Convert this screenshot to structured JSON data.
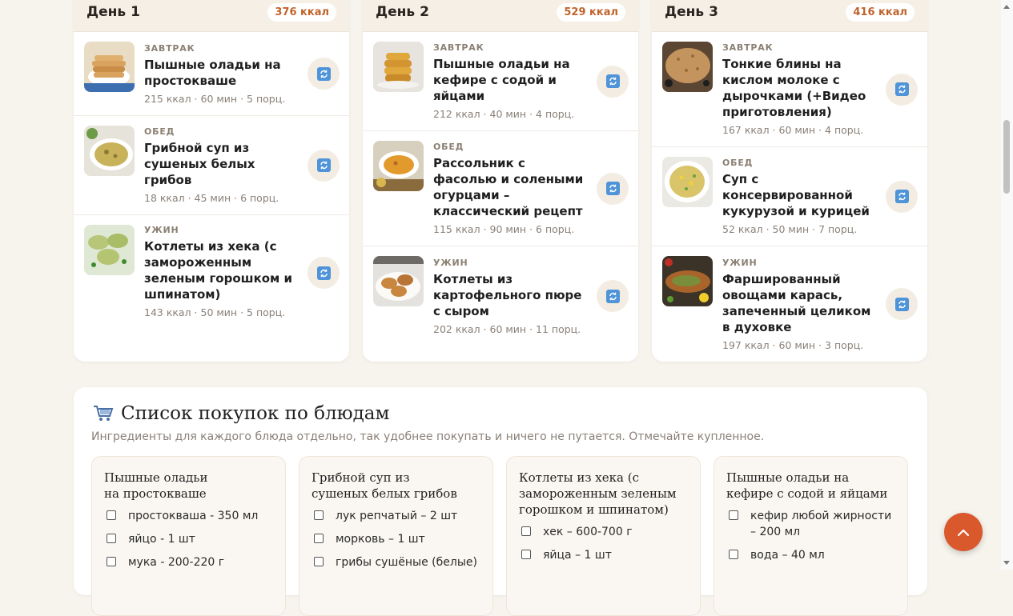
{
  "days": [
    {
      "title": "День 1",
      "kcal": "376 ккал",
      "meals": [
        {
          "type": "ЗАВТРАК",
          "name": "Пышные оладьи на простокваше",
          "meta": "215 ккал · 60 мин · 5 порц.",
          "image": "pancakes-photo"
        },
        {
          "type": "ОБЕД",
          "name": "Грибной суп из сушеных белых грибов",
          "meta": "18 ккал · 45 мин · 6 порц.",
          "image": "mushroom-soup-photo"
        },
        {
          "type": "УЖИН",
          "name": "Котлеты из хека (с замороженным зеленым горошком и шпинатом)",
          "meta": "143 ккал · 50 мин · 5 порц.",
          "image": "fish-cutlets-photo"
        }
      ]
    },
    {
      "title": "День 2",
      "kcal": "529 ккал",
      "meals": [
        {
          "type": "ЗАВТРАК",
          "name": "Пышные оладьи на кефире с содой и яйцами",
          "meta": "212 ккал · 40 мин · 4 порц.",
          "image": "kefir-pancakes-photo"
        },
        {
          "type": "ОБЕД",
          "name": "Рассольник с фасолью и солеными огурцами – классический рецепт",
          "meta": "115 ккал · 90 мин · 6 порц.",
          "image": "rassolnik-photo"
        },
        {
          "type": "УЖИН",
          "name": "Котлеты из картофельного пюре с сыром",
          "meta": "202 ккал · 60 мин · 11 порц.",
          "image": "potato-cutlets-photo"
        }
      ]
    },
    {
      "title": "День 3",
      "kcal": "416 ккал",
      "meals": [
        {
          "type": "ЗАВТРАК",
          "name": "Тонкие блины на кислом молоке с дырочками (+Видео приготовления)",
          "meta": "167 ккал · 60 мин · 4 порц.",
          "image": "crepes-photo"
        },
        {
          "type": "ОБЕД",
          "name": "Суп с консервированной кукурузой и курицей",
          "meta": "52 ккал · 50 мин · 7 порц.",
          "image": "corn-soup-photo"
        },
        {
          "type": "УЖИН",
          "name": "Фаршированный овощами карась, запеченный целиком в духовке",
          "meta": "197 ккал · 60 мин · 3 порц.",
          "image": "stuffed-fish-photo"
        }
      ]
    }
  ],
  "shopping": {
    "icon": "cart-icon",
    "title": "Список покупок по блюдам",
    "subtitle": "Ингредиенты для каждого блюда отдельно, так удобнее покупать и ничего не путается. Отмечайте купленное.",
    "dishes": [
      {
        "title": "Пышные оладьи на простокваше",
        "items": [
          "простокваша - 350 мл",
          "яйцо - 1 шт",
          "мука - 200-220 г"
        ]
      },
      {
        "title": "Грибной суп из сушеных белых грибов",
        "items": [
          "лук репчатый – 2 шт",
          "морковь – 1 шт",
          "грибы сушёные (белые)"
        ]
      },
      {
        "title": "Котлеты из хека (с замороженным зеленым горошком и шпинатом)",
        "items": [
          "хек – 600-700 г",
          "яйца – 1 шт"
        ]
      },
      {
        "title": "Пышные оладьи на кефире с содой и яйцами",
        "items": [
          "кефир любой жирности – 200 мл",
          "вода – 40 мл"
        ]
      }
    ]
  },
  "colors": {
    "accent": "#d9582c",
    "kcal": "#c0632b",
    "swap_icon": "#4f94d8",
    "background": "#f7f3ed"
  },
  "scroll_top_icon": "chevron-up-icon",
  "swap_icon": "swap-icon"
}
